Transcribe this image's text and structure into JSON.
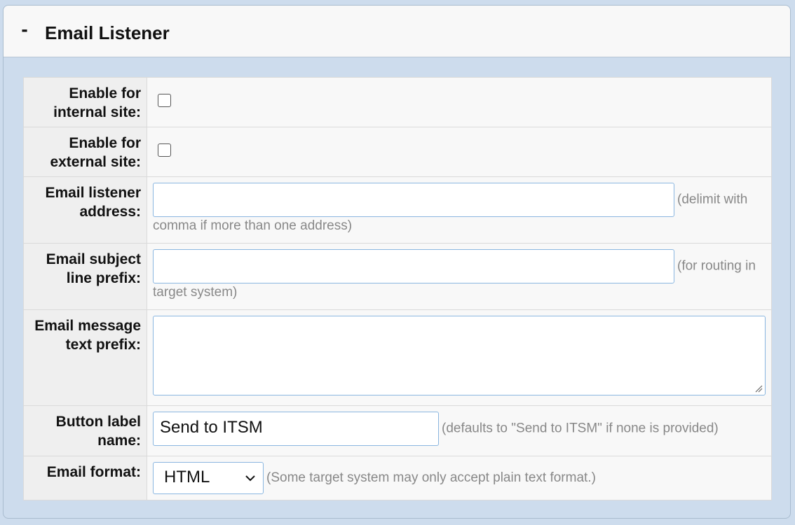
{
  "panel": {
    "toggle": "-",
    "title": "Email Listener"
  },
  "fields": {
    "internal": {
      "label": "Enable for internal site:",
      "checked": false
    },
    "external": {
      "label": "Enable for external site:",
      "checked": false
    },
    "address": {
      "label": "Email listener address:",
      "value": "",
      "hint": "(delimit with comma if more than one address)"
    },
    "subject": {
      "label": "Email subject line prefix:",
      "value": "",
      "hint": "(for routing in target system)"
    },
    "message": {
      "label": "Email message text prefix:",
      "value": ""
    },
    "button_label": {
      "label": "Button label name:",
      "value": "Send to ITSM",
      "hint": "(defaults to \"Send to ITSM\" if none is provided)"
    },
    "format": {
      "label": "Email format:",
      "selected": "HTML",
      "hint": "(Some target system may only accept plain text format.)"
    }
  }
}
